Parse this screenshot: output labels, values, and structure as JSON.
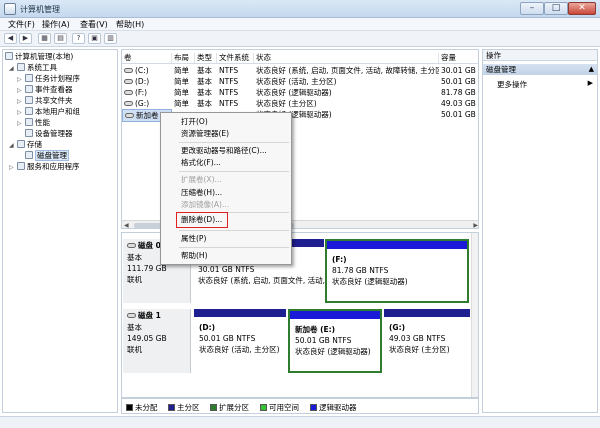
{
  "window": {
    "title": "计算机管理",
    "min": "–",
    "max": "□",
    "close": "✕"
  },
  "menu": [
    "文件(F)",
    "操作(A)",
    "查看(V)",
    "帮助(H)"
  ],
  "toolbar": [
    "◀",
    "▶",
    "▦",
    "?",
    "▤",
    "▣",
    "▥"
  ],
  "tree": {
    "root": "计算机管理(本地)",
    "system_tools": "系统工具",
    "task_scheduler": "任务计划程序",
    "event_viewer": "事件查看器",
    "shared_folders": "共享文件夹",
    "local_users": "本地用户和组",
    "performance": "性能",
    "device_manager": "设备管理器",
    "storage": "存储",
    "disk_management": "磁盘管理",
    "services": "服务和应用程序"
  },
  "volumes": {
    "headers": [
      "卷",
      "布局",
      "类型",
      "文件系统",
      "状态",
      "容量"
    ],
    "rows": [
      [
        "(C:)",
        "简单",
        "基本",
        "NTFS",
        "状态良好 (系统, 启动, 页面文件, 活动, 故障转储, 主分区)",
        "30.01 GB"
      ],
      [
        "(D:)",
        "简单",
        "基本",
        "NTFS",
        "状态良好 (活动, 主分区)",
        "50.01 GB"
      ],
      [
        "(F:)",
        "简单",
        "基本",
        "NTFS",
        "状态良好 (逻辑驱动器)",
        "81.78 GB"
      ],
      [
        "(G:)",
        "简单",
        "基本",
        "NTFS",
        "状态良好 (主分区)",
        "49.03 GB"
      ],
      [
        "新加卷 (E:)",
        "",
        "",
        "",
        "状态良好 (逻辑驱动器)",
        "50.01 GB"
      ]
    ]
  },
  "disk0": {
    "name": "磁盘 0",
    "type": "基本",
    "size": "111.79 GB",
    "status": "联机",
    "part1": {
      "size": "30.01 GB NTFS",
      "status": "状态良好 (系统, 启动, 页面文件, 活动,"
    },
    "part2": {
      "name": "(F:)",
      "size": "81.78 GB NTFS",
      "status": "状态良好 (逻辑驱动器)"
    }
  },
  "disk1": {
    "name": "磁盘 1",
    "type": "基本",
    "size": "149.05 GB",
    "status": "联机",
    "part1": {
      "name": "(D:)",
      "size": "50.01 GB NTFS",
      "status": "状态良好 (活动, 主分区)"
    },
    "part2": {
      "name": "新加卷 (E:)",
      "size": "50.01 GB NTFS",
      "status": "状态良好 (逻辑驱动器)"
    },
    "part3": {
      "name": "(G:)",
      "size": "49.03 GB NTFS",
      "status": "状态良好 (主分区)"
    }
  },
  "legend": [
    "未分配",
    "主分区",
    "扩展分区",
    "可用空间",
    "逻辑驱动器"
  ],
  "actions": {
    "header": "操作",
    "section": "磁盘管理",
    "more": "更多操作"
  },
  "context_menu": {
    "open": "打开(O)",
    "explorer": "资源管理器(E)",
    "change_letter": "更改驱动器号和路径(C)...",
    "format": "格式化(F)...",
    "extend": "扩展卷(X)...",
    "shrink": "压缩卷(H)...",
    "mirror": "添加镜像(A)...",
    "delete": "删除卷(D)...",
    "properties": "属性(P)",
    "help": "帮助(H)"
  },
  "colors": {
    "unallocated": "#000000",
    "primary": "#1f1f8f",
    "extended": "#2e7d2e",
    "free": "#34c134",
    "logical": "#1a1ad8",
    "delete_highlight": "#e02020"
  }
}
